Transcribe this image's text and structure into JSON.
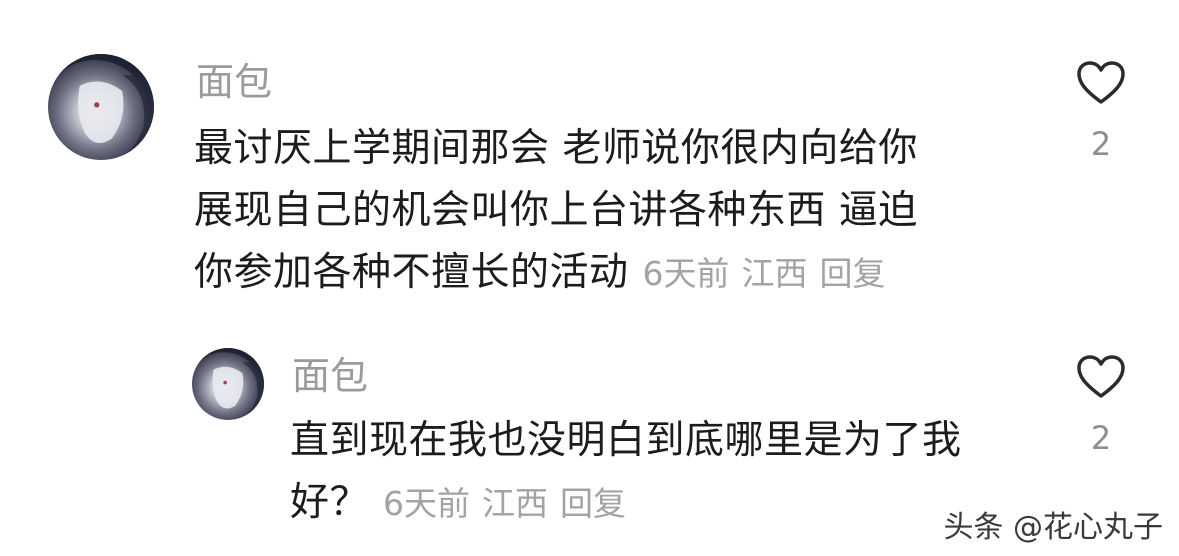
{
  "comments": [
    {
      "username": "面包",
      "lines": [
        "最讨厌上学期间那会 老师说你很内向给你",
        "展现自己的机会叫你上台讲各种东西 逼迫",
        "你参加各种不擅长的活动"
      ],
      "time": "6天前",
      "location": "江西",
      "reply_label": "回复",
      "likes": "2"
    },
    {
      "username": "面包",
      "lines": [
        "直到现在我也没明白到底哪里是为了我",
        "好？"
      ],
      "time": "6天前",
      "location": "江西",
      "reply_label": "回复",
      "likes": "2"
    }
  ],
  "watermark": "头条 @花心丸子",
  "icons": {
    "like": "heart-outline-icon",
    "avatar": "avatar-image"
  }
}
